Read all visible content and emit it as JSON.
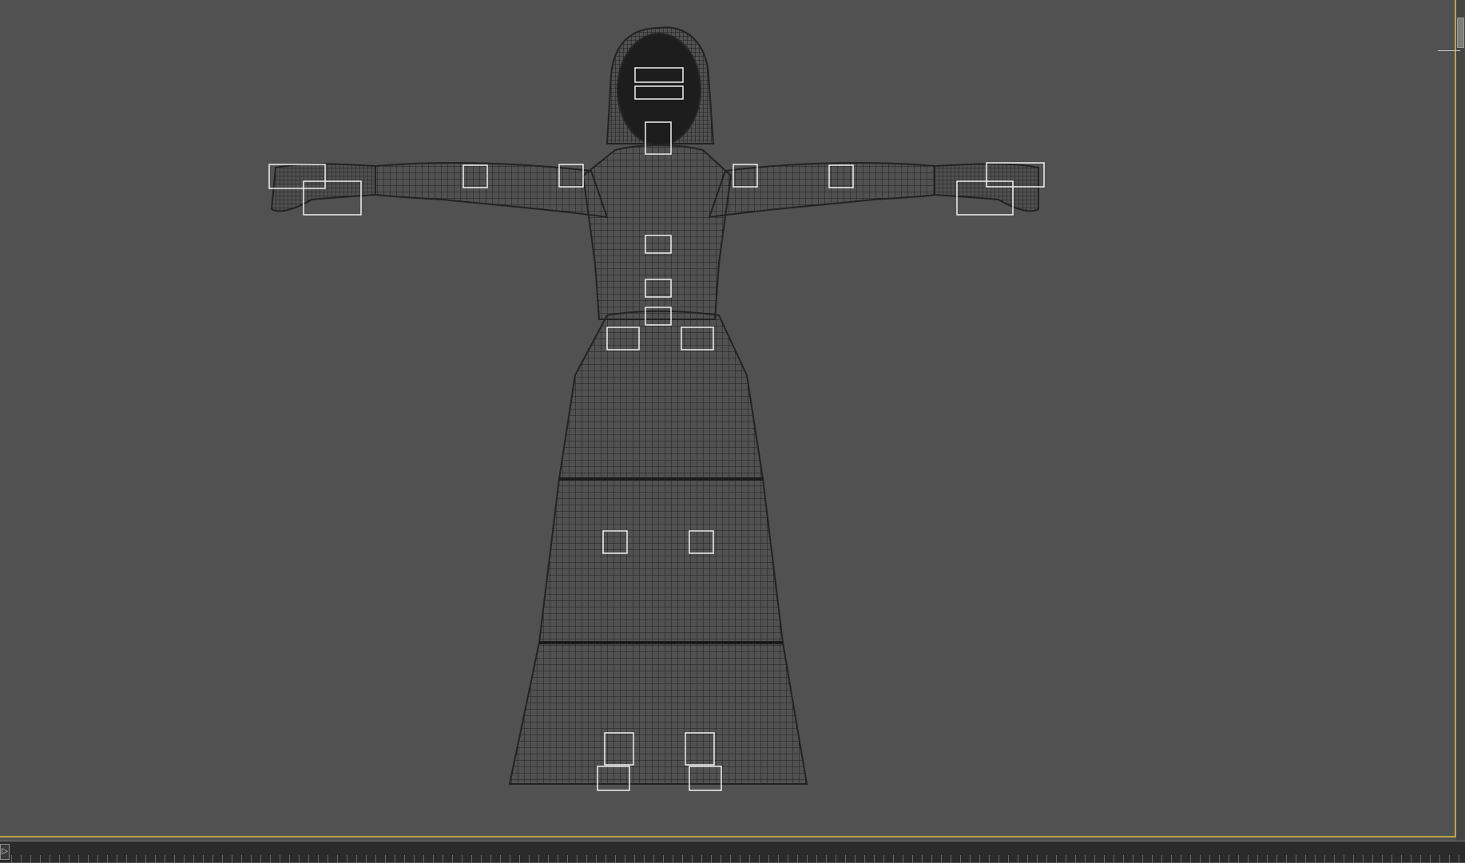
{
  "viewport": {
    "background_color": "#515151",
    "border_color": "#b9a64a",
    "wire_color": "#1f1f1f",
    "bone_marker_color": "#f1f1f1"
  },
  "timeline": {
    "play_icon": "▷"
  }
}
